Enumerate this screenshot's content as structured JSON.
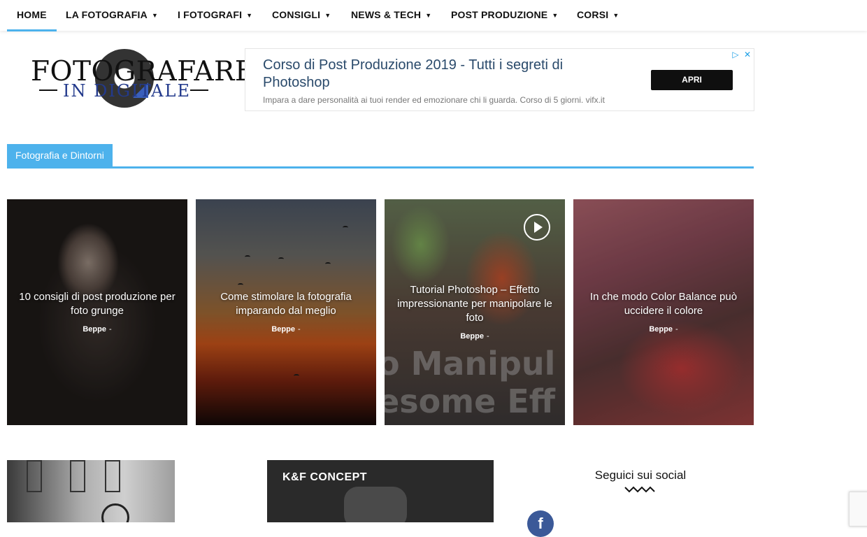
{
  "nav": {
    "items": [
      {
        "label": "HOME",
        "has_menu": false,
        "active": true
      },
      {
        "label": "LA FOTOGRAFIA",
        "has_menu": true
      },
      {
        "label": "I FOTOGRAFI",
        "has_menu": true
      },
      {
        "label": "CONSIGLI",
        "has_menu": true
      },
      {
        "label": "NEWS & TECH",
        "has_menu": true
      },
      {
        "label": "POST PRODUZIONE",
        "has_menu": true
      },
      {
        "label": "CORSI",
        "has_menu": true
      }
    ],
    "chevron_icon": "chevron-down-icon",
    "accent_color": "#4db2ec"
  },
  "logo": {
    "line1": "FOTOGRAFARE",
    "line2": "IN DIGITALE"
  },
  "ad": {
    "title": "Corso di Post Produzione 2019 - Tutti i segreti di Photoshop",
    "description": "Impara a dare personalità ai tuoi render ed emozionare chi li guarda. Corso di 5 giorni. vifx.it",
    "button": "APRI",
    "adchoices_icon": "adchoices-icon",
    "close_icon": "close-icon"
  },
  "section": {
    "tag": "Fotografia e Dintorni"
  },
  "cards": [
    {
      "title": "10 consigli di post produzione per foto grunge",
      "author": "Beppe",
      "sep": "-"
    },
    {
      "title": "Come stimolare la fotografia imparando dal meglio",
      "author": "Beppe",
      "sep": "-"
    },
    {
      "title": "Tutorial Photoshop – Effetto impressionante per manipolare le foto",
      "author": "Beppe",
      "sep": "-",
      "image_text_1": "o Manipul",
      "image_text_2": "esome Eff",
      "video_icon": "play-icon"
    },
    {
      "title": "In che modo Color Balance può uccidere il colore",
      "author": "Beppe",
      "sep": "-"
    }
  ],
  "bottom": {
    "promo_brand": "K&F CONCEPT",
    "social_title": "Seguici sui social",
    "social_icon": "facebook-icon"
  }
}
